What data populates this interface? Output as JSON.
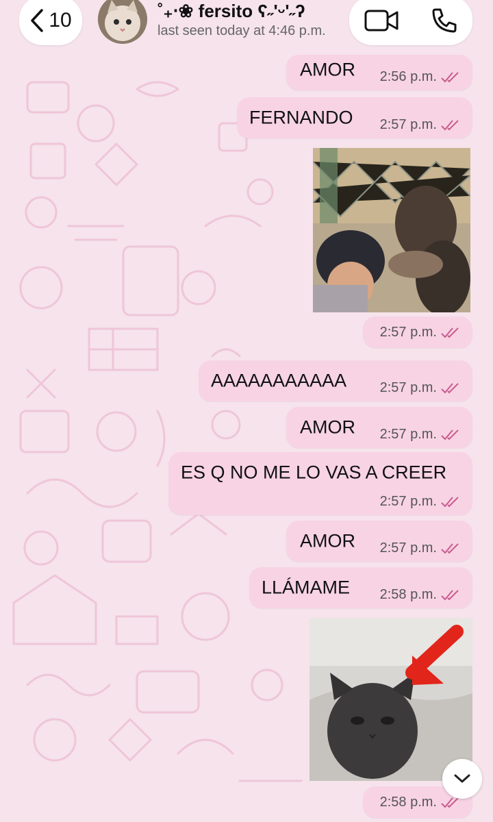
{
  "header": {
    "back_count": "10",
    "contact_name": "˚₊‧❀ fersito ʕ˶'ᵕ'˶ʔ",
    "status": "last seen today at 4:46 p.m.",
    "icons": {
      "back": "chevron-left-icon",
      "video": "video-camera-icon",
      "call": "phone-icon"
    }
  },
  "messages": [
    {
      "text": "AMOR",
      "time": "2:56 p.m."
    },
    {
      "text": "FERNANDO",
      "time": "2:57 p.m."
    },
    {
      "image": "boy-and-monkey-at-fence",
      "time": "2:57 p.m."
    },
    {
      "text": "AAAAAAAAAAA",
      "time": "2:57 p.m."
    },
    {
      "text": "AMOR",
      "time": "2:57 p.m."
    },
    {
      "text": "ES Q NO ME LO VAS A CREER",
      "time": "2:57 p.m."
    },
    {
      "text": "AMOR",
      "time": "2:57 p.m."
    },
    {
      "text": "LLÁMAME",
      "time": "2:58 p.m."
    },
    {
      "image": "cat-with-red-arrow",
      "time": "2:58 p.m."
    }
  ],
  "colors": {
    "background": "#f6e3ec",
    "bubble": "#f7d3e4",
    "read_ticks": "#c95b8f",
    "doodles": "#efc7d8"
  }
}
